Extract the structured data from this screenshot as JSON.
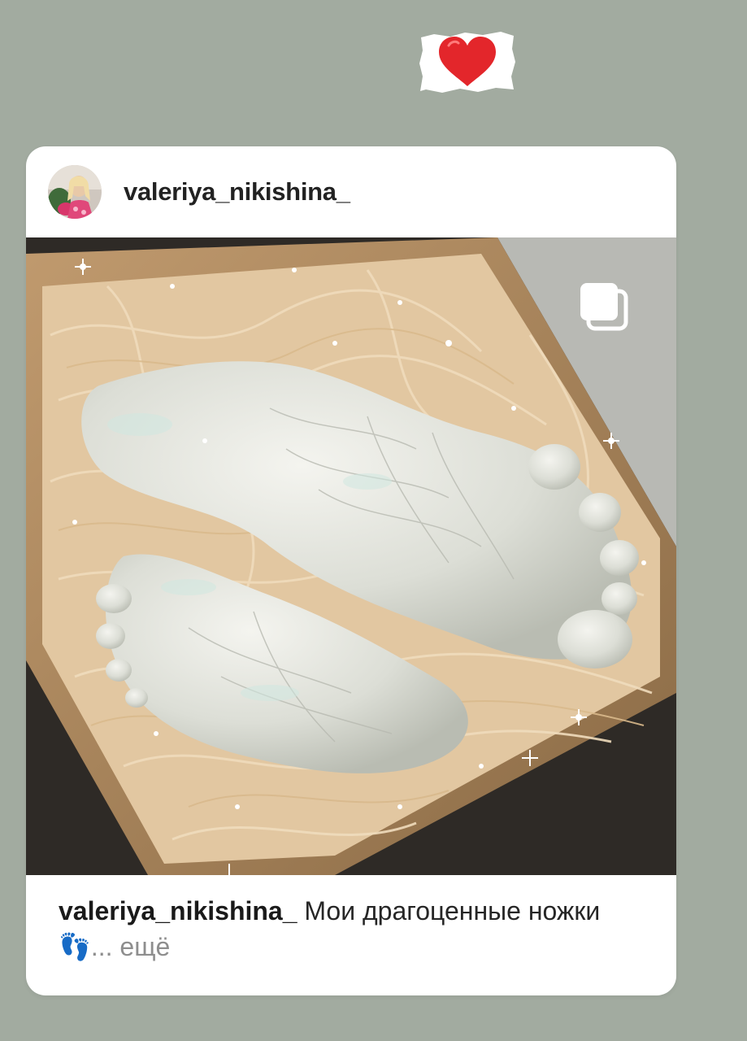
{
  "sticker": {
    "icon": "heart-icon",
    "heart_color": "#e3262b"
  },
  "post": {
    "username": "valeriya_nikishina_",
    "multi_photo_icon": "multiple-photos-icon",
    "caption": {
      "username": "valeriya_nikishina_",
      "text": "Мои драгоценные ножки",
      "emoji": "👣",
      "more": "... ещё"
    }
  },
  "colors": {
    "background": "#a2aba0",
    "card": "#ffffff",
    "username_text": "#222222",
    "more_text": "#8e8e8e"
  }
}
